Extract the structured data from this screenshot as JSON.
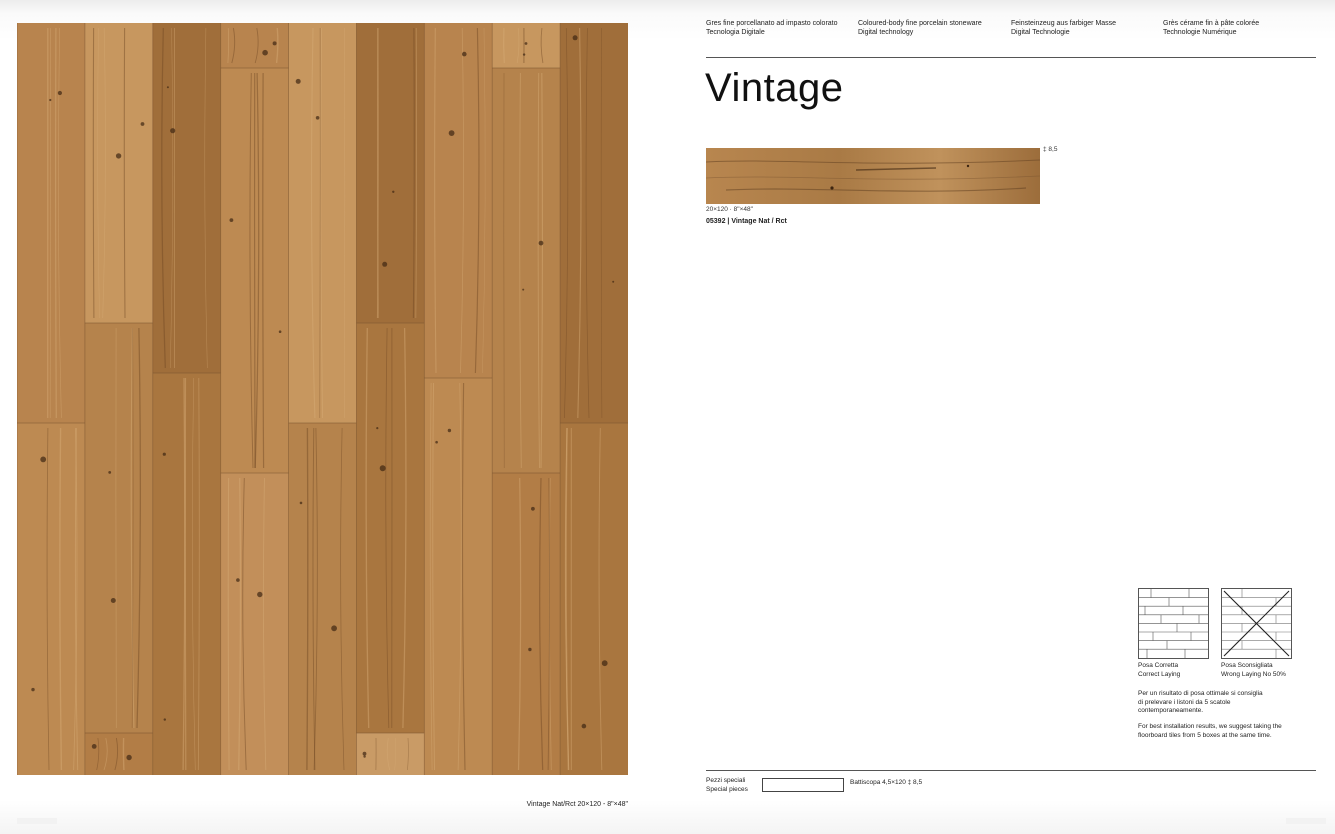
{
  "floor": {
    "caption": "Vintage Nat/Rct 20×120 - 8\"×48\"",
    "plank_colors": [
      "#b8844e",
      "#c28f5a",
      "#a9763f",
      "#c7975f",
      "#b27d46",
      "#bd8a52",
      "#a06e3a",
      "#c99b66",
      "#b5834c"
    ]
  },
  "header": {
    "tech": [
      {
        "line1": "Gres fine porcellanato ad impasto colorato",
        "line2": "Tecnologia Digitale"
      },
      {
        "line1": "Coloured-body fine porcelain stoneware",
        "line2": "Digital technology"
      },
      {
        "line1": "Feinsteinzeug aus farbiger Masse",
        "line2": "Digital Technologie"
      },
      {
        "line1": "Grès cérame fin à pâte colorée",
        "line2": "Technologie Numérique"
      }
    ]
  },
  "product": {
    "title": "Vintage",
    "thickness": "‡ 8,5",
    "size": "20×120 · 8\"×48\"",
    "code": "05392 | Vintage Nat / Rct"
  },
  "laying": {
    "correct": {
      "it": "Posa Corretta",
      "en": "Correct Laying"
    },
    "wrong": {
      "it": "Posa Sconsigliata",
      "en": "Wrong Laying No 50%"
    },
    "note_it": "Per un risultato di posa ottimale si consiglia di prelevare i listoni da 5 scatole contemporaneamente.",
    "note_en": "For best installation results, we suggest taking the floorboard tiles from 5 boxes at the same time."
  },
  "special": {
    "label_it": "Pezzi speciali",
    "label_en": "Special pieces",
    "skirting": "Battiscopa 4,5×120  ‡ 8,5"
  }
}
